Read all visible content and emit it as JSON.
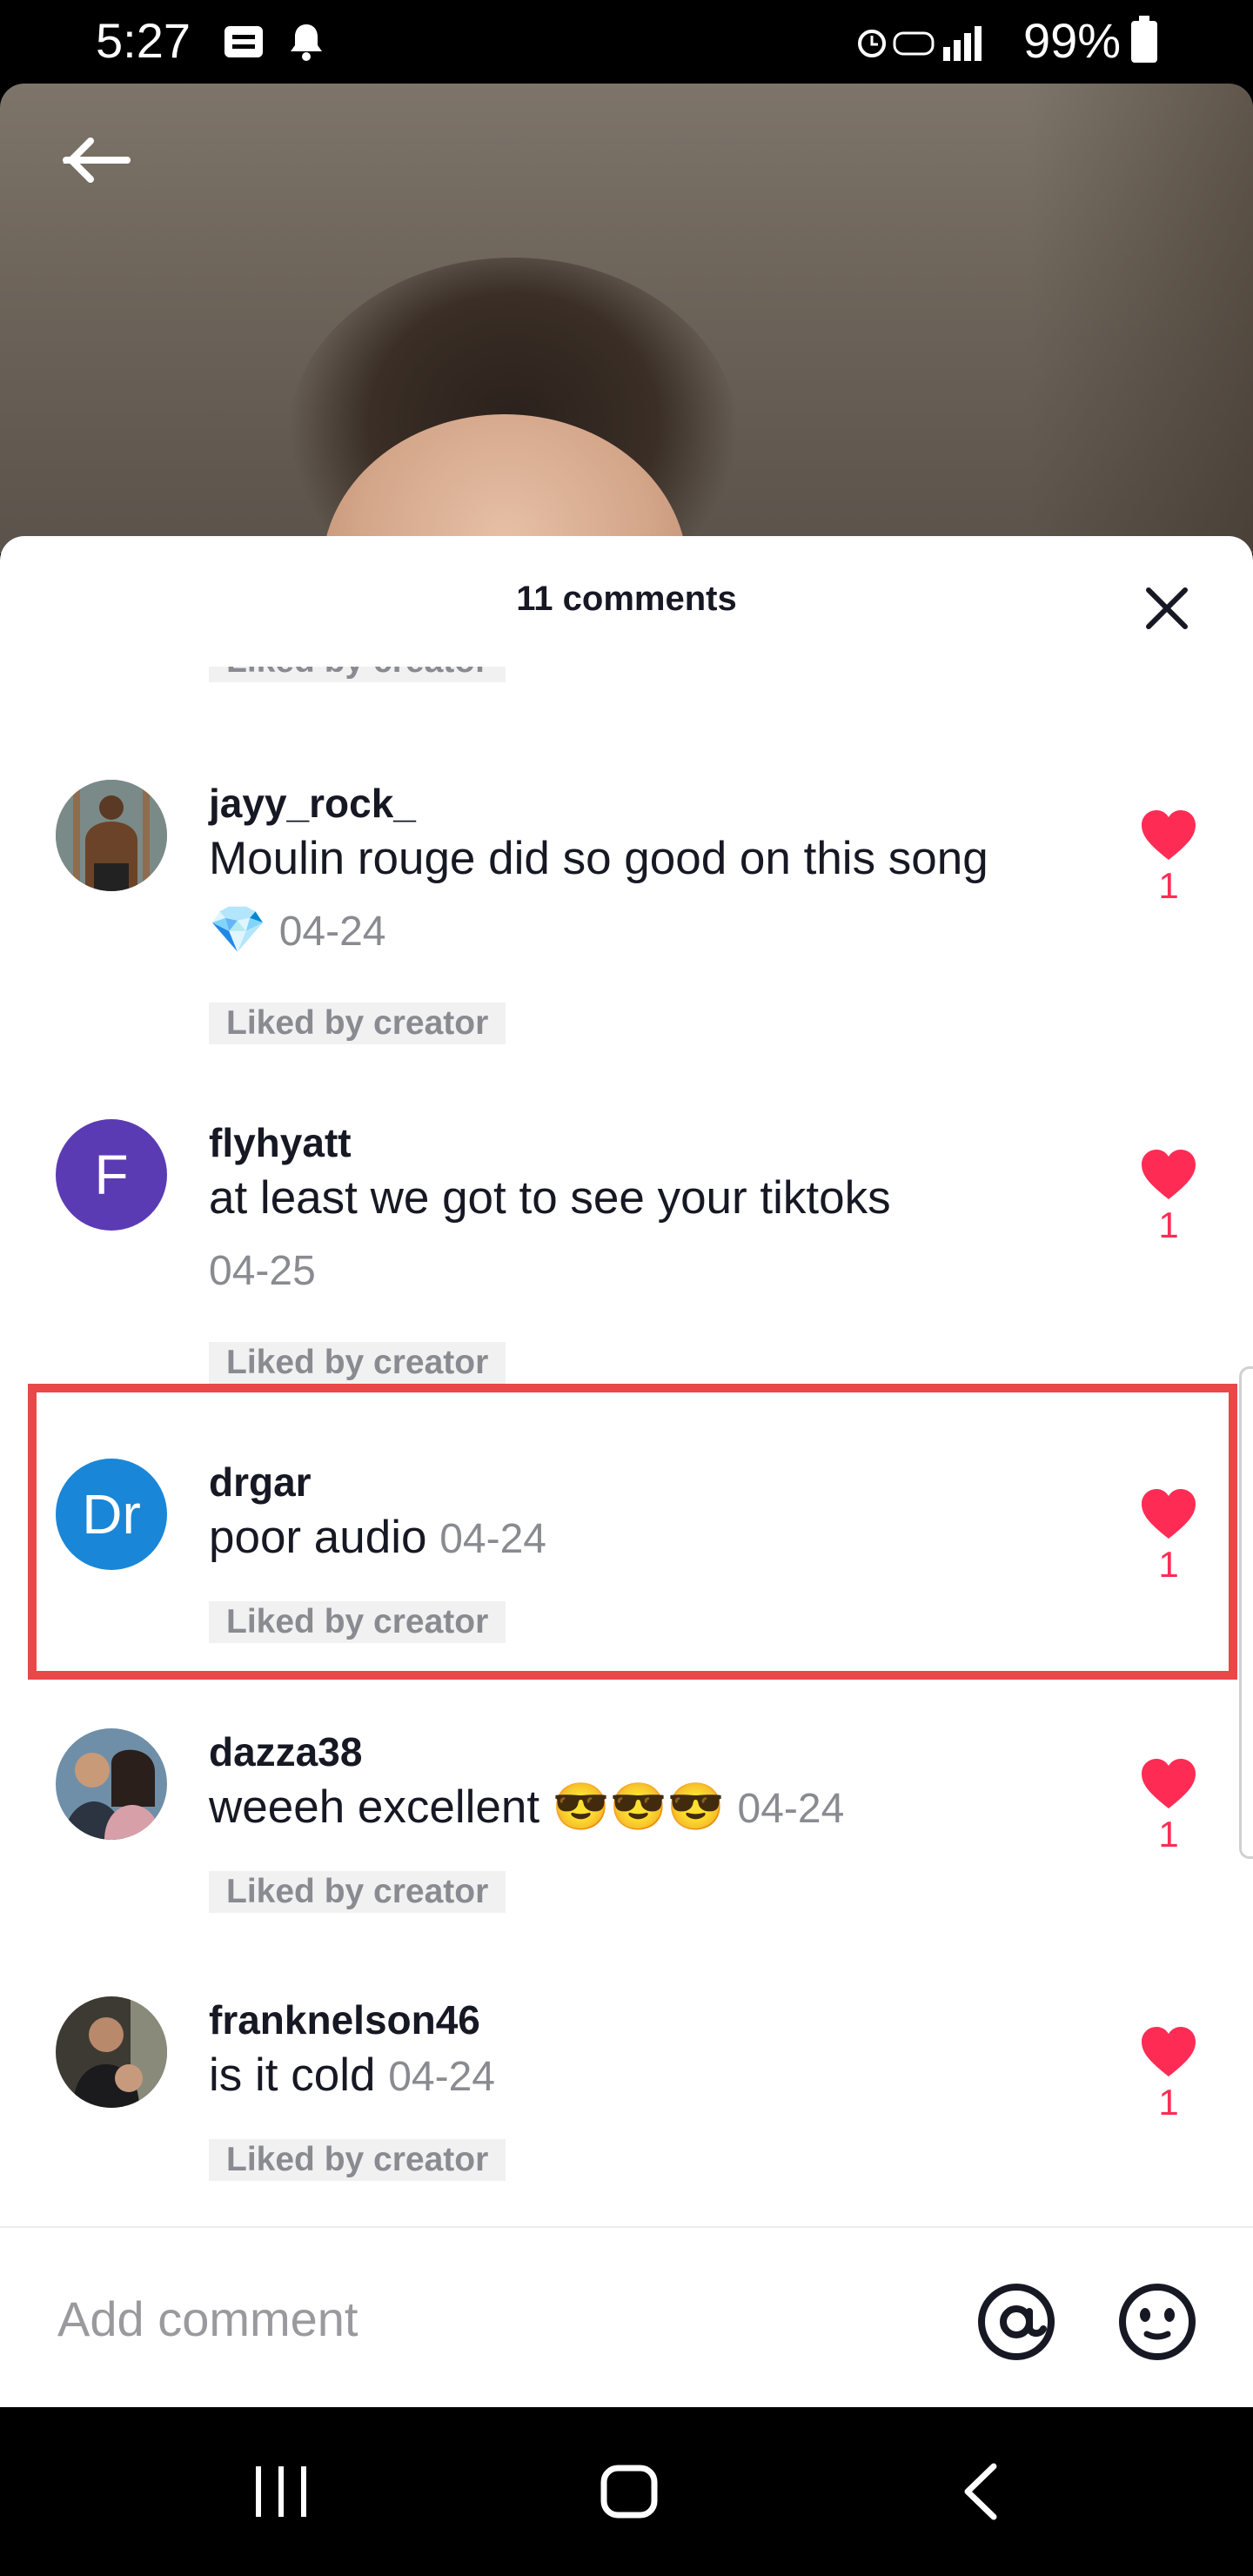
{
  "status_bar": {
    "time": "5:27",
    "battery": "99%"
  },
  "sheet": {
    "title": "11 comments"
  },
  "comments": [
    {
      "username": "",
      "text": "",
      "date": "",
      "liked_label": "Liked by creator",
      "likes": ""
    },
    {
      "username": "jayy_rock_",
      "text": "Moulin rouge did so good on this song 💎",
      "date": "04-24",
      "liked_label": "Liked by creator",
      "likes": "1"
    },
    {
      "username": "flyhyatt",
      "text": "at least we got to see your tiktoks",
      "date": "04-25",
      "liked_label": "Liked by creator",
      "likes": "1",
      "avatar_letter": "F",
      "avatar_color": "#5b3bb4"
    },
    {
      "username": "drgar",
      "text": "poor audio",
      "date": "04-24",
      "liked_label": "Liked by creator",
      "likes": "1",
      "avatar_letter": "Dr",
      "avatar_color": "#1a86d7"
    },
    {
      "username": "dazza38",
      "text": "weeeh excellent 😎😎😎",
      "date": "04-24",
      "liked_label": "Liked by creator",
      "likes": "1"
    },
    {
      "username": "franknelson46",
      "text": "is it cold",
      "date": "04-24",
      "liked_label": "Liked by creator",
      "likes": "1"
    }
  ],
  "input": {
    "placeholder": "Add comment"
  },
  "colors": {
    "accent": "#fe2c55",
    "highlight": "#ea4848"
  }
}
